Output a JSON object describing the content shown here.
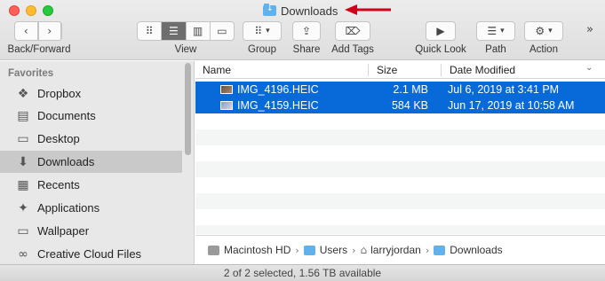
{
  "window": {
    "title": "Downloads"
  },
  "toolbar": {
    "back_forward_label": "Back/Forward",
    "view_label": "View",
    "group_label": "Group",
    "share_label": "Share",
    "add_tags_label": "Add Tags",
    "quick_look_label": "Quick Look",
    "path_label": "Path",
    "action_label": "Action",
    "active_view": "list"
  },
  "sidebar": {
    "heading": "Favorites",
    "items": [
      {
        "label": "Dropbox",
        "icon": "dropbox-icon"
      },
      {
        "label": "Documents",
        "icon": "documents-icon"
      },
      {
        "label": "Desktop",
        "icon": "desktop-icon"
      },
      {
        "label": "Downloads",
        "icon": "downloads-icon",
        "selected": true
      },
      {
        "label": "Recents",
        "icon": "recents-icon"
      },
      {
        "label": "Applications",
        "icon": "applications-icon"
      },
      {
        "label": "Wallpaper",
        "icon": "folder-icon"
      },
      {
        "label": "Creative Cloud Files",
        "icon": "creative-cloud-icon"
      }
    ]
  },
  "columns": {
    "name": "Name",
    "size": "Size",
    "date_modified": "Date Modified"
  },
  "files": [
    {
      "name": "IMG_4196.HEIC",
      "size": "2.1 MB",
      "date": "Jul 6, 2019 at 3:41 PM",
      "selected": true
    },
    {
      "name": "IMG_4159.HEIC",
      "size": "584 KB",
      "date": "Jun 17, 2019 at 10:58 AM",
      "selected": true
    }
  ],
  "pathbar": {
    "segments": [
      "Macintosh HD",
      "Users",
      "larryjordan",
      "Downloads"
    ]
  },
  "status": {
    "text": "2 of 2 selected, 1.56 TB available"
  },
  "colors": {
    "selection": "#0869d9",
    "folder": "#5fb2ec",
    "arrow": "#d0021b"
  }
}
